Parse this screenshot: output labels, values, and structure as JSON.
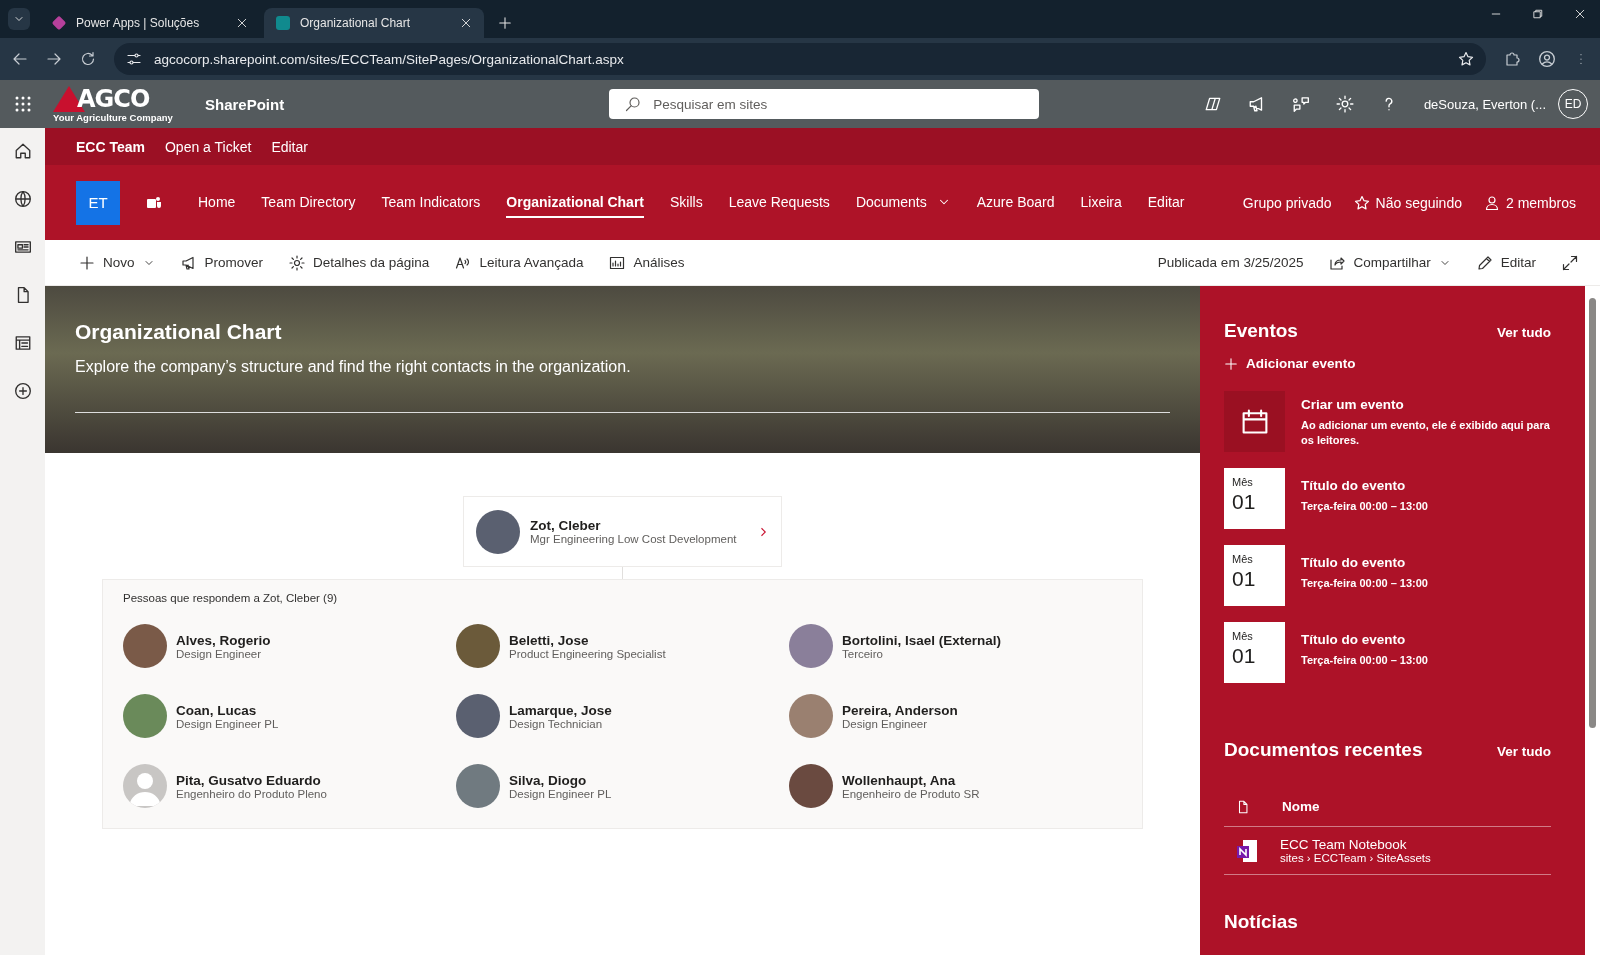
{
  "browser": {
    "tabs": [
      {
        "title": "Power Apps | Soluções",
        "selected": false
      },
      {
        "title": "Organizational Chart",
        "selected": true
      }
    ],
    "url": "agcocorp.sharepoint.com/sites/ECCTeam/SitePages/OrganizationalChart.aspx"
  },
  "suite_bar": {
    "logo": "AGCO",
    "tagline": "Your Agriculture Company",
    "app_name": "SharePoint",
    "search": {
      "placeholder": "Pesquisar em sites"
    },
    "user_name": "deSouza, Everton (...",
    "user_initials": "ED"
  },
  "hub_nav": [
    {
      "label": "ECC Team",
      "kind": "hub"
    },
    {
      "label": "Open a Ticket",
      "kind": "link"
    },
    {
      "label": "Editar",
      "kind": "link"
    }
  ],
  "site_header": {
    "logo_initials": "ET",
    "nav": [
      {
        "label": "Home",
        "selected": false,
        "has_menu": false
      },
      {
        "label": "Team Directory",
        "selected": false,
        "has_menu": false
      },
      {
        "label": "Team Indicators",
        "selected": false,
        "has_menu": false
      },
      {
        "label": "Organizational Chart",
        "selected": true,
        "has_menu": false
      },
      {
        "label": "Skills",
        "selected": false,
        "has_menu": false
      },
      {
        "label": "Leave Requests",
        "selected": false,
        "has_menu": false
      },
      {
        "label": "Documents",
        "selected": false,
        "has_menu": true
      },
      {
        "label": "Azure Board",
        "selected": false,
        "has_menu": false
      },
      {
        "label": "Lixeira",
        "selected": false,
        "has_menu": false
      },
      {
        "label": "Editar",
        "selected": false,
        "has_menu": false
      }
    ],
    "privacy": "Grupo privado",
    "follow": "Não seguindo",
    "members": "2 membros"
  },
  "command_bar": {
    "left": [
      {
        "label": "Novo",
        "has_menu": true
      },
      {
        "label": "Promover",
        "has_menu": false
      },
      {
        "label": "Detalhes da página",
        "has_menu": false
      },
      {
        "label": "Leitura Avançada",
        "has_menu": false
      },
      {
        "label": "Análises",
        "has_menu": false
      }
    ],
    "published": "Publicada em 3/25/2025",
    "share": "Compartilhar",
    "edit": "Editar"
  },
  "hero": {
    "title": "Organizational Chart",
    "subtitle": "Explore the company’s structure and find the right contacts in the organization."
  },
  "org_chart": {
    "manager": {
      "name": "Zot, Cleber",
      "title": "Mgr Engineering Low Cost Development"
    },
    "reports_heading": "Pessoas que respondem a Zot, Cleber (9)",
    "reports": [
      {
        "name": "Alves, Rogerio",
        "title": "Design Engineer",
        "kind": "photo"
      },
      {
        "name": "Beletti, Jose",
        "title": "Product Engineering Specialist",
        "kind": "photo"
      },
      {
        "name": "Bortolini, Isael (External)",
        "title": "Terceiro",
        "kind": "photo"
      },
      {
        "name": "Coan, Lucas",
        "title": "Design Engineer PL",
        "kind": "photo"
      },
      {
        "name": "Lamarque, Jose",
        "title": "Design Technician",
        "kind": "photo"
      },
      {
        "name": "Pereira, Anderson",
        "title": "Design Engineer",
        "kind": "photo"
      },
      {
        "name": "Pita, Gusatvo Eduardo",
        "title": "Engenheiro do Produto Pleno",
        "kind": "default"
      },
      {
        "name": "Silva, Diogo",
        "title": "Design Engineer PL",
        "kind": "photo"
      },
      {
        "name": "Wollenhaupt, Ana",
        "title": "Engenheiro de Produto SR",
        "kind": "photo"
      }
    ]
  },
  "events": {
    "title": "Eventos",
    "see_all": "Ver tudo",
    "add": "Adicionar evento",
    "create": {
      "title": "Criar um evento",
      "text": "Ao adicionar um evento, ele é exibido aqui para os leitores."
    },
    "items": [
      {
        "month": "Mês",
        "day": "01",
        "title": "Título do evento",
        "time": "Terça-feira 00:00 – 13:00"
      },
      {
        "month": "Mês",
        "day": "01",
        "title": "Título do evento",
        "time": "Terça-feira 00:00 – 13:00"
      },
      {
        "month": "Mês",
        "day": "01",
        "title": "Título do evento",
        "time": "Terça-feira 00:00 – 13:00"
      }
    ]
  },
  "documents": {
    "title": "Documentos recentes",
    "see_all": "Ver tudo",
    "column": "Nome",
    "items": [
      {
        "name": "ECC Team Notebook",
        "path": "sites › ECCTeam › SiteAssets"
      }
    ]
  },
  "news": {
    "title": "Notícias"
  }
}
